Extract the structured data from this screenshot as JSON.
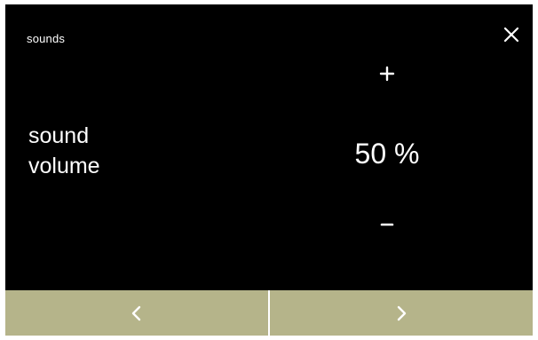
{
  "header": {
    "title": "sounds",
    "close_icon": "close-icon"
  },
  "setting": {
    "label_line1": "sound",
    "label_line2": "volume",
    "value_display": "50 %",
    "volume_percent": 50,
    "increase_icon": "plus-icon",
    "decrease_icon": "minus-icon"
  },
  "footer": {
    "prev_icon": "chevron-left-icon",
    "next_icon": "chevron-right-icon"
  },
  "colors": {
    "screen_background": "#000000",
    "text": "#ffffff",
    "nav_button_background": "#b5b48a",
    "nav_divider": "#ffffff"
  }
}
